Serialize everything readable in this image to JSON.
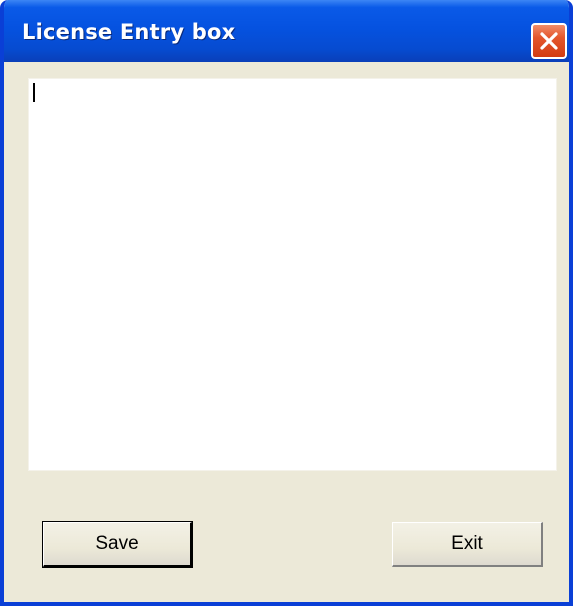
{
  "window": {
    "title": "License Entry box",
    "close_icon": "close-icon"
  },
  "license_input": {
    "value": ""
  },
  "buttons": {
    "save_label": "Save",
    "exit_label": "Exit"
  },
  "colors": {
    "titlebar": "#0552e0",
    "window_body": "#ece9d8",
    "close_button": "#e4562c"
  }
}
